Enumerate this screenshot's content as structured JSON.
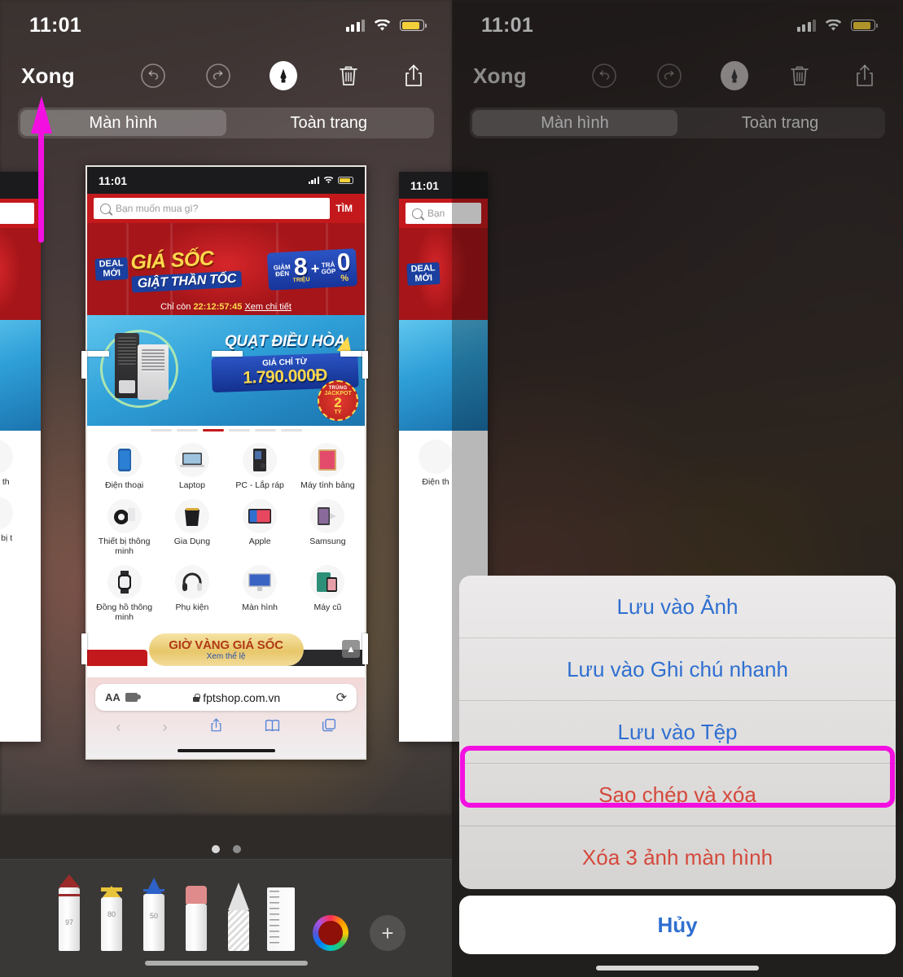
{
  "status_bar": {
    "time": "11:01"
  },
  "markup_toolbar": {
    "done_label": "Xong",
    "icons": [
      "undo-icon",
      "redo-icon",
      "markup-pen-icon",
      "trash-icon",
      "share-icon"
    ]
  },
  "segmented_control": {
    "options": [
      "Màn hình",
      "Toàn trang"
    ],
    "selected": "Màn hình"
  },
  "screenshot_preview": {
    "status_time": "11:01",
    "search": {
      "placeholder": "Bạn muốn mua gì?",
      "button_label": "TÌM"
    },
    "banner_deal": {
      "tag_line1": "DEAL",
      "tag_line2": "MỚI",
      "headline": "GIÁ SỐC",
      "subhead": "GIẬT THẦN TỐC",
      "discount_label_1": "GIẢM",
      "discount_label_2": "ĐẾN",
      "discount_value": "8",
      "discount_unit": "TRIỆU",
      "plus": "+",
      "installment_label_1": "TRẢ",
      "installment_label_2": "GÓP",
      "installment_value": "0",
      "installment_unit": "%",
      "countdown_prefix": "Chỉ còn",
      "countdown_value": "22:12:57:45",
      "countdown_link": "Xem chi tiết"
    },
    "banner_cooler": {
      "title": "QUẠT ĐIỀU HÒA",
      "price_label": "GIÁ CHỈ TỪ",
      "price": "1.790.000Đ",
      "badge_line1": "TRÚNG",
      "badge_line2": "JACKPOT",
      "badge_line3": "2",
      "badge_line4": "TỶ"
    },
    "categories": [
      {
        "label": "Điện thoại",
        "icon": "phone-icon"
      },
      {
        "label": "Laptop",
        "icon": "laptop-icon"
      },
      {
        "label": "PC - Lắp ráp",
        "icon": "desktop-tower-icon"
      },
      {
        "label": "Máy tính bảng",
        "icon": "tablet-icon"
      },
      {
        "label": "Thiết bị thông minh",
        "icon": "smart-device-icon"
      },
      {
        "label": "Gia Dụng",
        "icon": "appliance-icon"
      },
      {
        "label": "Apple",
        "icon": "apple-icon"
      },
      {
        "label": "Samsung",
        "icon": "samsung-icon"
      },
      {
        "label": "Đồng hồ thông minh",
        "icon": "smartwatch-icon"
      },
      {
        "label": "Phụ kiện",
        "icon": "headphone-icon"
      },
      {
        "label": "Màn hình",
        "icon": "monitor-icon"
      },
      {
        "label": "Máy cũ",
        "icon": "used-device-icon"
      }
    ],
    "gold_banner": {
      "title": "GIỜ VÀNG GIÁ SỐC",
      "subtitle": "Xem thể lệ"
    },
    "safari": {
      "text_size_label": "AA",
      "url": "fptshop.com.vn",
      "reload_icon": "reload-icon",
      "back_icon": "chevron-left-icon",
      "forward_icon": "chevron-right-icon",
      "share_icon": "share-icon",
      "bookmarks_icon": "book-icon",
      "tabs_icon": "tabs-icon"
    }
  },
  "markup_tools": {
    "pen_opacity": "97",
    "highlighter_opacity": "80",
    "pencil_opacity": "50",
    "tools": [
      "pen-tool",
      "highlighter-tool",
      "pencil-tool",
      "eraser-tool",
      "lasso-tool",
      "ruler-tool"
    ],
    "color_swatch": "#8E1008",
    "add_color_label": "+",
    "page_dots": 2,
    "active_page_dot": 1
  },
  "action_sheet": {
    "items": [
      {
        "label": "Lưu vào Ảnh",
        "style": "default"
      },
      {
        "label": "Lưu vào Ghi chú nhanh",
        "style": "default"
      },
      {
        "label": "Lưu vào Tệp",
        "style": "default"
      },
      {
        "label": "Sao chép và xóa",
        "style": "destructive",
        "highlighted": true
      },
      {
        "label": "Xóa 3 ảnh màn hình",
        "style": "destructive"
      }
    ],
    "cancel_label": "Hủy"
  },
  "annotations": {
    "highlight_color": "#F20FE0",
    "arrow_target": "Xong",
    "box_target": "Sao chép và xóa"
  }
}
